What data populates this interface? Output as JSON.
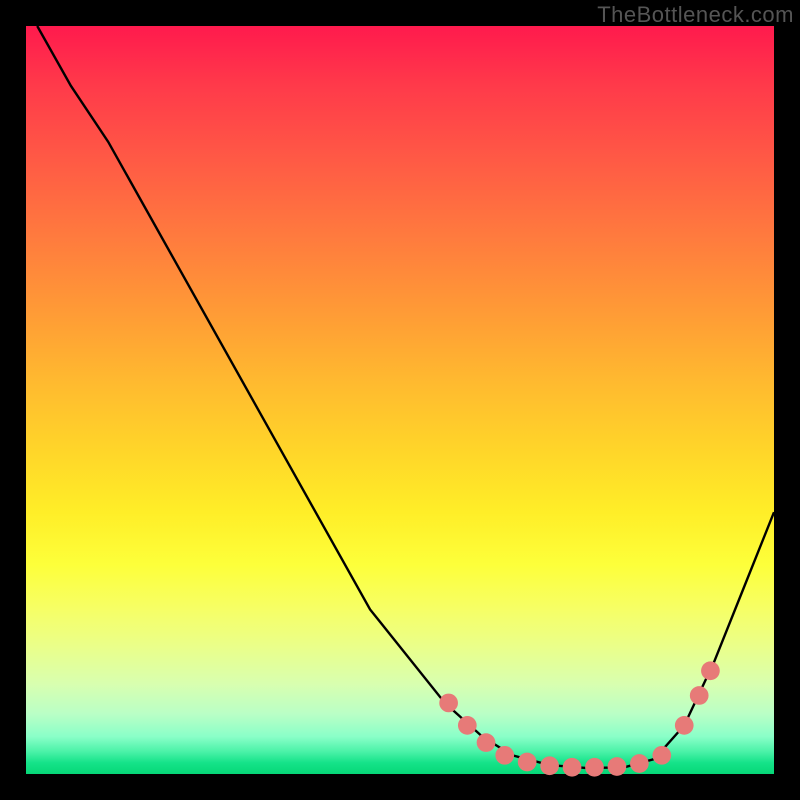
{
  "watermark": "TheBottleneck.com",
  "chart_data": {
    "type": "line",
    "title": "",
    "xlabel": "",
    "ylabel": "",
    "xlim": [
      0,
      100
    ],
    "ylim": [
      0,
      100
    ],
    "series": [
      {
        "name": "curve",
        "points": [
          {
            "x": 1.5,
            "y": 100
          },
          {
            "x": 6,
            "y": 92
          },
          {
            "x": 11,
            "y": 84.5
          },
          {
            "x": 46,
            "y": 22
          },
          {
            "x": 56,
            "y": 9.5
          },
          {
            "x": 61,
            "y": 5
          },
          {
            "x": 65,
            "y": 2.5
          },
          {
            "x": 70,
            "y": 1.2
          },
          {
            "x": 75,
            "y": 0.8
          },
          {
            "x": 80,
            "y": 0.9
          },
          {
            "x": 84,
            "y": 2
          },
          {
            "x": 88,
            "y": 6.5
          },
          {
            "x": 92,
            "y": 15
          },
          {
            "x": 96,
            "y": 25
          },
          {
            "x": 100,
            "y": 35
          }
        ]
      }
    ],
    "markers": [
      {
        "x": 56.5,
        "y": 9.5
      },
      {
        "x": 59,
        "y": 6.5
      },
      {
        "x": 61.5,
        "y": 4.2
      },
      {
        "x": 64,
        "y": 2.5
      },
      {
        "x": 67,
        "y": 1.6
      },
      {
        "x": 70,
        "y": 1.1
      },
      {
        "x": 73,
        "y": 0.9
      },
      {
        "x": 76,
        "y": 0.9
      },
      {
        "x": 79,
        "y": 1.0
      },
      {
        "x": 82,
        "y": 1.4
      },
      {
        "x": 85,
        "y": 2.5
      },
      {
        "x": 88,
        "y": 6.5
      },
      {
        "x": 90,
        "y": 10.5
      },
      {
        "x": 91.5,
        "y": 13.8
      }
    ],
    "gradient_stops": [
      {
        "pos": 0,
        "color": "#ff1a4d"
      },
      {
        "pos": 50,
        "color": "#ffd629"
      },
      {
        "pos": 80,
        "color": "#f6ff66"
      },
      {
        "pos": 100,
        "color": "#06d777"
      }
    ],
    "marker_color": "#e77a78",
    "line_color": "#000000"
  }
}
